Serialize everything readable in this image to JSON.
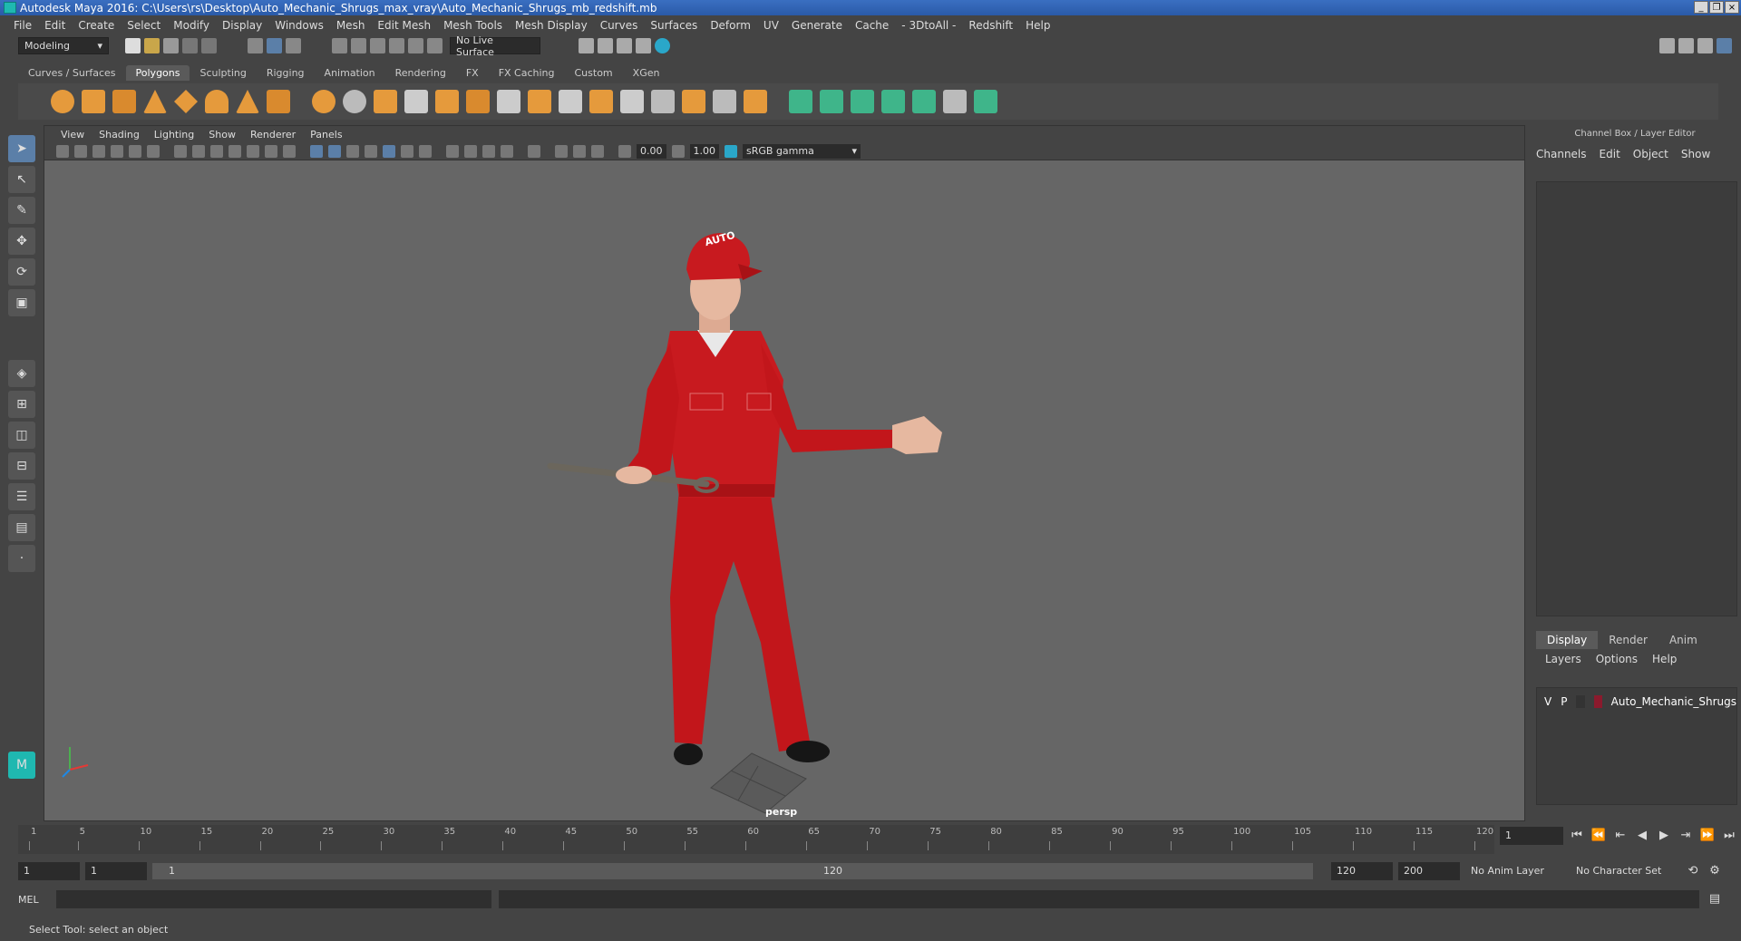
{
  "window": {
    "title": "Autodesk Maya 2016: C:\\Users\\rs\\Desktop\\Auto_Mechanic_Shrugs_max_vray\\Auto_Mechanic_Shrugs_mb_redshift.mb",
    "buttons": [
      "_",
      "×"
    ]
  },
  "menu": [
    "File",
    "Edit",
    "Create",
    "Select",
    "Modify",
    "Display",
    "Windows",
    "Mesh",
    "Edit Mesh",
    "Mesh Tools",
    "Mesh Display",
    "Curves",
    "Surfaces",
    "Deform",
    "UV",
    "Generate",
    "Cache",
    "- 3DtoAll -",
    "Redshift",
    "Help"
  ],
  "status": {
    "mode": "Modeling",
    "live_surface": "No Live Surface"
  },
  "shelf_tabs": [
    "Curves / Surfaces",
    "Polygons",
    "Sculpting",
    "Rigging",
    "Animation",
    "Rendering",
    "FX",
    "FX Caching",
    "Custom",
    "XGen"
  ],
  "shelf_active": "Polygons",
  "viewport": {
    "menu": [
      "View",
      "Shading",
      "Lighting",
      "Show",
      "Renderer",
      "Panels"
    ],
    "exposure": "0.00",
    "gamma": "1.00",
    "color_space": "sRGB gamma",
    "camera": "persp",
    "hat_text": "AUTO"
  },
  "channel_box": {
    "title": "Channel Box / Layer Editor",
    "menu": [
      "Channels",
      "Edit",
      "Object",
      "Show"
    ]
  },
  "layer_editor": {
    "tabs": [
      "Display",
      "Render",
      "Anim"
    ],
    "active_tab": "Display",
    "menu": [
      "Layers",
      "Options",
      "Help"
    ],
    "layers": [
      {
        "v": "V",
        "p": "P",
        "name": "Auto_Mechanic_Shrugs",
        "color": "#8b1a2d"
      }
    ]
  },
  "timeline": {
    "ticks": [
      "1",
      "5",
      "10",
      "15",
      "20",
      "25",
      "30",
      "35",
      "40",
      "45",
      "50",
      "55",
      "60",
      "65",
      "70",
      "75",
      "80",
      "85",
      "90",
      "95",
      "100",
      "105",
      "110",
      "115",
      "120"
    ],
    "current_frame": "1"
  },
  "range": {
    "start": "1",
    "playback_start": "1",
    "slider_start": "1",
    "slider_end": "120",
    "playback_end": "120",
    "end": "200",
    "anim_layer": "No Anim Layer",
    "character_set": "No Character Set"
  },
  "command": {
    "label": "MEL"
  },
  "help_line": "Select Tool: select an object"
}
